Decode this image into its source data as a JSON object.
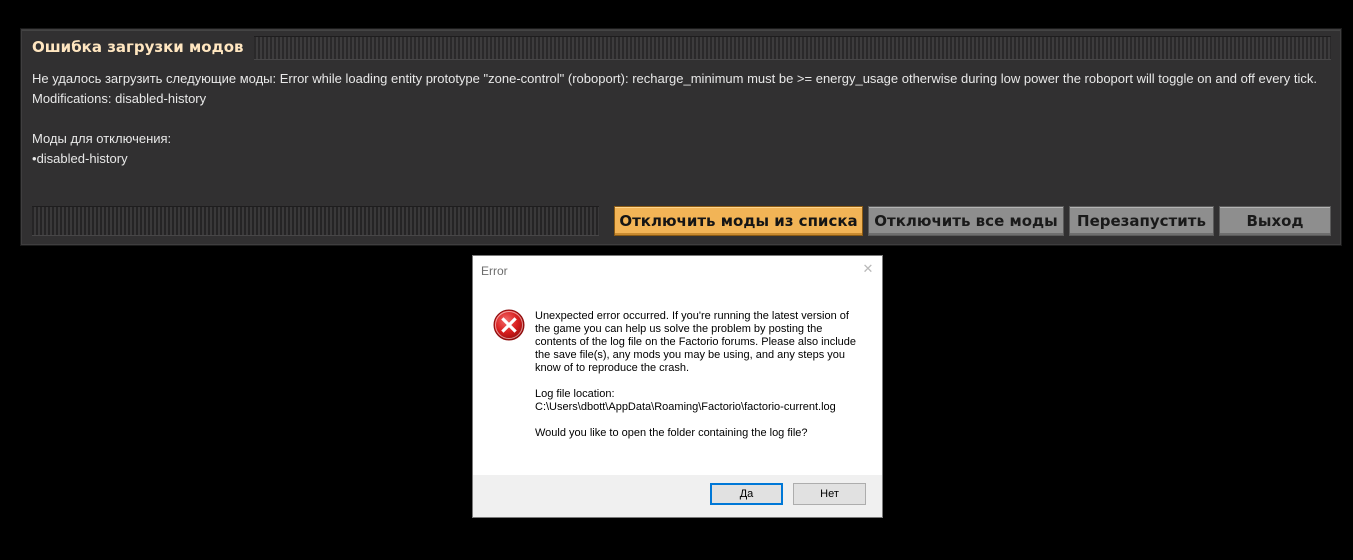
{
  "mod_error_panel": {
    "title": "Ошибка загрузки модов",
    "message_line1": "Не удалось загрузить следующие моды: Error while loading entity prototype \"zone-control\" (roboport): recharge_minimum must be >= energy_usage otherwise during low power the roboport will toggle on and off every tick.",
    "message_line2": "Modifications: disabled-history",
    "disable_heading": "Моды для отключения:",
    "disable_items": [
      "disabled-history"
    ],
    "buttons": {
      "disable_listed": "Отключить моды из списка",
      "disable_all": "Отключить все моды",
      "restart": "Перезапустить",
      "exit": "Выход"
    }
  },
  "error_dialog": {
    "title": "Error",
    "close_glyph": "✕",
    "icon": "error-icon",
    "paragraph1": "Unexpected error occurred. If you're running the latest version of the game you can help us solve the problem by posting the contents of the log file on the Factorio forums. Please also include the save file(s), any mods you may be using, and any steps you know of to reproduce the crash.",
    "log_label": "Log file location:",
    "log_path": "C:\\Users\\dbott\\AppData\\Roaming\\Factorio\\factorio-current.log",
    "question": "Would you like to open the folder containing the log file?",
    "buttons": {
      "yes": "Да",
      "no": "Нет"
    }
  },
  "colors": {
    "panel_bg": "#313031",
    "title_color": "#ffe6c0",
    "orange_button": "#f2b456",
    "grey_button": "#8e8e8e",
    "error_red": "#d81e1e"
  }
}
